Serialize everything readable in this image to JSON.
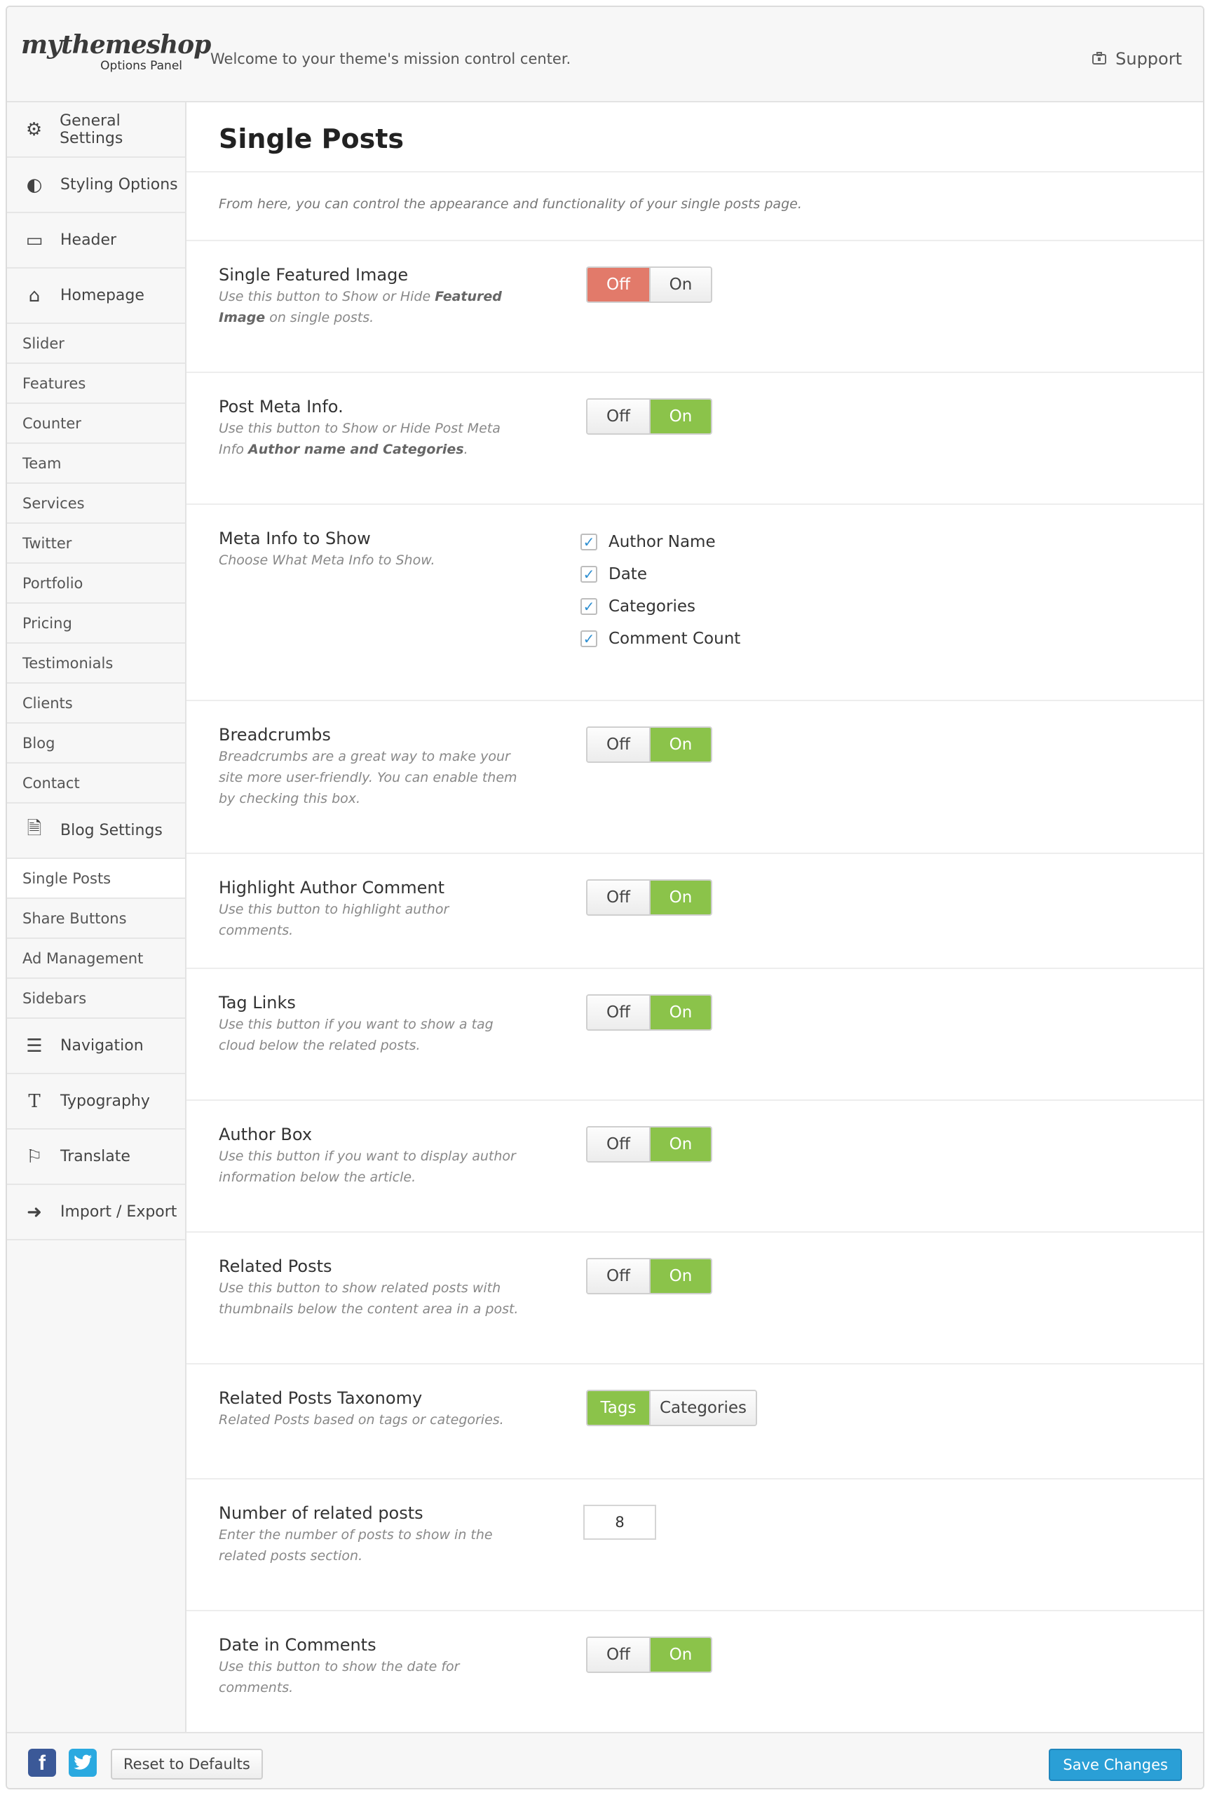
{
  "header": {
    "logo_text": "mythemeshop",
    "logo_sub": "Options Panel",
    "welcome": "Welcome to your theme's mission control center.",
    "support_label": "Support",
    "support_icon": "briefcase-icon"
  },
  "sidebar": {
    "main_items": [
      {
        "label": "General Settings",
        "icon": "gears-icon"
      },
      {
        "label": "Styling Options",
        "icon": "contrast-icon"
      },
      {
        "label": "Header",
        "icon": "header-card-icon"
      },
      {
        "label": "Homepage",
        "icon": "home-icon"
      },
      {
        "label": "Blog Settings",
        "icon": "document-icon"
      },
      {
        "label": "Navigation",
        "icon": "list-icon"
      },
      {
        "label": "Typography",
        "icon": "text-icon"
      },
      {
        "label": "Translate",
        "icon": "flag-icon"
      },
      {
        "label": "Import / Export",
        "icon": "import-icon"
      }
    ],
    "homepage_subitems": [
      "Slider",
      "Features",
      "Counter",
      "Team",
      "Services",
      "Twitter",
      "Portfolio",
      "Pricing",
      "Testimonials",
      "Clients",
      "Blog",
      "Contact"
    ],
    "blog_subitems": [
      "Single Posts",
      "Share Buttons",
      "Ad Management",
      "Sidebars"
    ],
    "active_item": "Single Posts"
  },
  "main": {
    "title": "Single Posts",
    "intro": "From here, you can control the appearance and functionality of your single posts page.",
    "settings": [
      {
        "title": "Single Featured Image",
        "desc_parts": [
          "Use this button to Show or Hide ",
          "Featured Image",
          " on single posts."
        ],
        "type": "toggle",
        "value": "Off"
      },
      {
        "title": "Post Meta Info.",
        "desc_parts": [
          "Use this button to Show or Hide Post Meta Info ",
          "Author name and Categories",
          "."
        ],
        "type": "toggle",
        "value": "On"
      },
      {
        "title": "Meta Info to Show",
        "desc": "Choose What Meta Info to Show.",
        "type": "checkboxes",
        "options": [
          "Author Name",
          "Date",
          "Categories",
          "Comment Count"
        ]
      },
      {
        "title": "Breadcrumbs",
        "desc": "Breadcrumbs are a great way to make your site more user-friendly. You can enable them by checking this box.",
        "type": "toggle",
        "value": "On"
      },
      {
        "title": "Highlight Author Comment",
        "desc": "Use this button to highlight author comments.",
        "type": "toggle",
        "value": "On"
      },
      {
        "title": "Tag Links",
        "desc": "Use this button if you want to show a tag cloud below the related posts.",
        "type": "toggle",
        "value": "On"
      },
      {
        "title": "Author Box",
        "desc": "Use this button if you want to display author information below the article.",
        "type": "toggle",
        "value": "On"
      },
      {
        "title": "Related Posts",
        "desc": "Use this button to show related posts with thumbnails below the content area in a post.",
        "type": "toggle",
        "value": "On"
      },
      {
        "title": "Related Posts Taxonomy",
        "desc": "Related Posts based on tags or categories.",
        "type": "segmented",
        "options": [
          "Tags",
          "Categories"
        ],
        "value": "Tags"
      },
      {
        "title": "Number of related posts",
        "desc": "Enter the number of posts to show in the related posts section.",
        "type": "number",
        "value": "8"
      },
      {
        "title": "Date in Comments",
        "desc": "Use this button to show the date for comments.",
        "type": "toggle",
        "value": "On"
      }
    ],
    "toggle_labels": {
      "off": "Off",
      "on": "On"
    }
  },
  "footer": {
    "facebook_icon": "facebook-icon",
    "twitter_icon": "twitter-icon",
    "reset_label": "Reset to Defaults",
    "save_label": "Save Changes"
  },
  "colors": {
    "off_active": "#e27a6a",
    "on_active": "#8bc34a",
    "save_button": "#2a9fd6"
  }
}
